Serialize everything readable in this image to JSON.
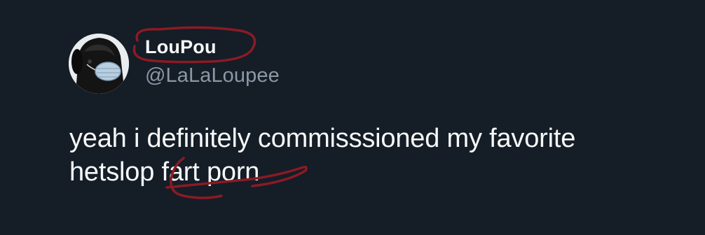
{
  "user": {
    "display_name": "LouPou",
    "handle": "@LaLaLoupee",
    "avatar_icon": "dog-with-mask-avatar-icon"
  },
  "tweet": {
    "line1": "yeah i definitely commisssioned my favorite",
    "line2": "hetslop fart porn"
  },
  "annotations": {
    "ink_color": "#8a1b24",
    "shape": "circle-annotation-icon"
  },
  "colors": {
    "background": "#151d27",
    "text": "#f7f9f9",
    "handle": "#8b98a5"
  }
}
